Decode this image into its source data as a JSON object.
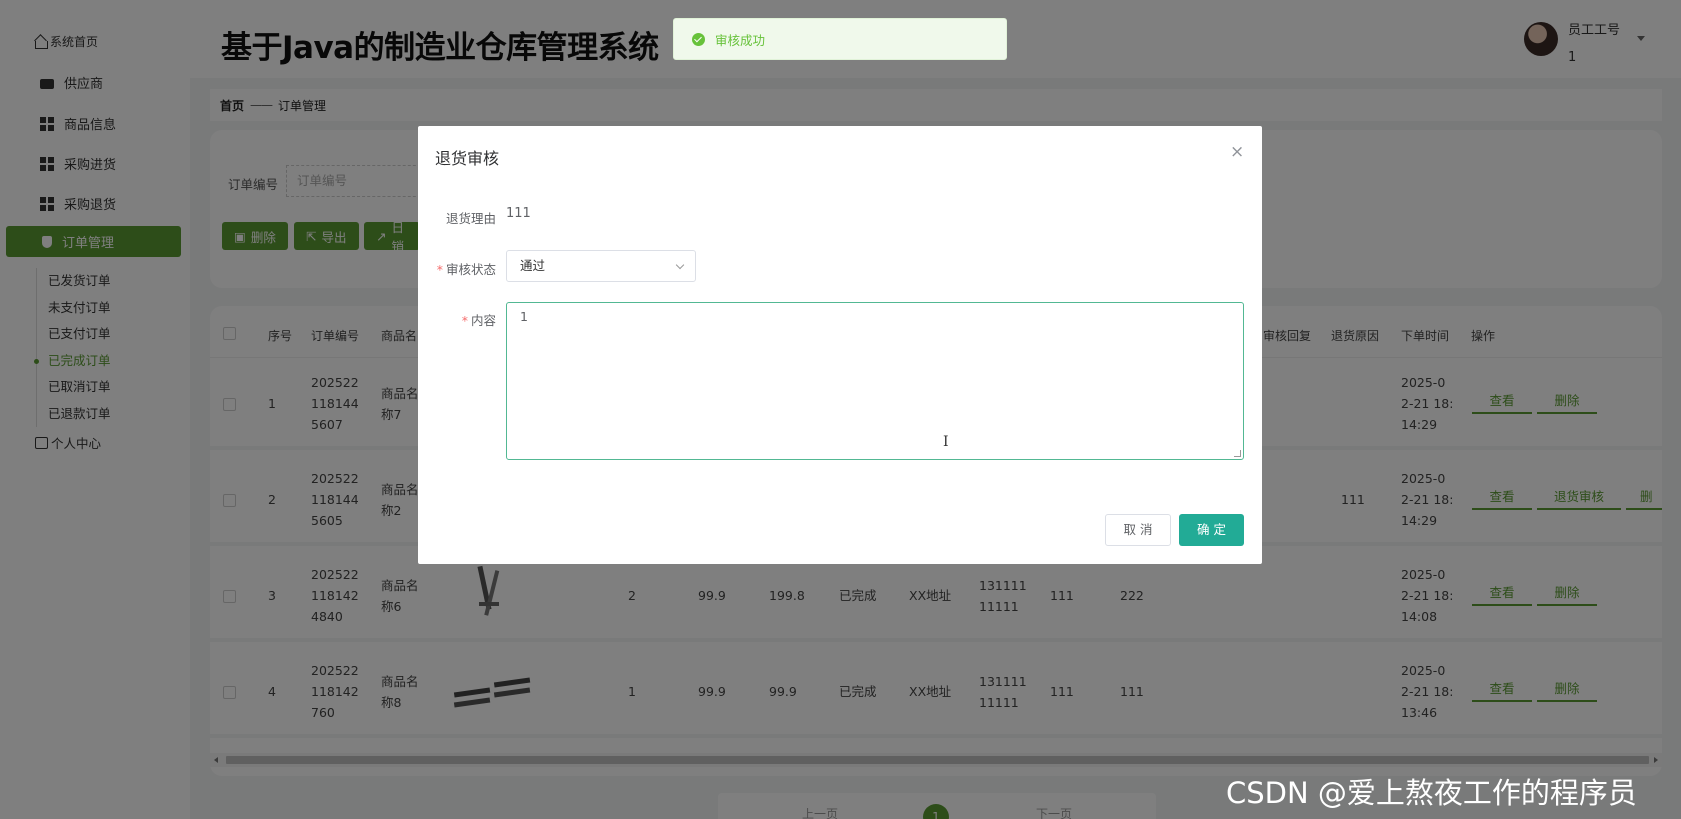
{
  "app_title": "基于Java的制造业仓库管理系统",
  "user": {
    "label": "员工工号",
    "id": "1"
  },
  "sidebar": {
    "home": "系统首页",
    "items": [
      "供应商",
      "商品信息",
      "采购进货",
      "采购退货"
    ],
    "active": "订单管理",
    "sub_items": [
      "已发货订单",
      "未支付订单",
      "已支付订单",
      "已完成订单",
      "已取消订单",
      "已退款订单"
    ],
    "active_sub": "已完成订单",
    "user_center": "个人中心"
  },
  "breadcrumb": {
    "home": "首页",
    "sep": "——",
    "current": "订单管理"
  },
  "search": {
    "label": "订单编号",
    "placeholder": "订单编号"
  },
  "toolbar": {
    "delete": "删除",
    "export": "导出",
    "sales": "日销"
  },
  "table": {
    "headers": [
      "序号",
      "订单编号",
      "商品名",
      "审核回复",
      "退货原因",
      "下单时间",
      "操作"
    ],
    "rows": [
      {
        "idx": "1",
        "order_no": "202522\n118144\n5607",
        "name": "商品名\n称7",
        "qty": "",
        "price": "",
        "total": "",
        "status": "",
        "addr": "",
        "phone": "",
        "c1": "",
        "c2": "",
        "reason": "",
        "time": "2025-0\n2-21 18:\n14:29",
        "actions": [
          "查看",
          "删除"
        ]
      },
      {
        "idx": "2",
        "order_no": "202522\n118144\n5605",
        "name": "商品名\n称2",
        "qty": "",
        "price": "",
        "total": "",
        "status": "",
        "addr": "",
        "phone": "",
        "c1": "",
        "c2": "",
        "reason": "111",
        "time": "2025-0\n2-21 18:\n14:29",
        "actions": [
          "查看",
          "退货审核",
          "删除"
        ]
      },
      {
        "idx": "3",
        "order_no": "202522\n118142\n4840",
        "name": "商品名\n称6",
        "qty": "2",
        "price": "99.9",
        "total": "199.8",
        "status": "已完成",
        "addr": "XX地址",
        "phone": "131111\n11111",
        "c1": "111",
        "c2": "222",
        "reason": "",
        "time": "2025-0\n2-21 18:\n14:08",
        "actions": [
          "查看",
          "删除"
        ]
      },
      {
        "idx": "4",
        "order_no": "202522\n118142\n760",
        "name": "商品名\n称8",
        "qty": "1",
        "price": "99.9",
        "total": "99.9",
        "status": "已完成",
        "addr": "XX地址",
        "phone": "131111\n11111",
        "c1": "111",
        "c2": "111",
        "reason": "",
        "time": "2025-0\n2-21 18:\n13:46",
        "actions": [
          "查看",
          "删除"
        ]
      }
    ]
  },
  "pager": {
    "prev": "上一页",
    "current": "1",
    "next": "下一页"
  },
  "dialog": {
    "title": "退货审核",
    "close": "×",
    "reason_label": "退货理由",
    "reason_value": "111",
    "status_label": "审核状态",
    "status_value": "通过",
    "content_label": "内容",
    "content_value": "1",
    "cancel": "取 消",
    "confirm": "确 定"
  },
  "toast": {
    "text": "审核成功"
  },
  "watermark": "CSDN @爱上熬夜工作的程序员",
  "colors": {
    "accent": "#5b9b33",
    "confirm": "#22ab96",
    "success": "#67c23a"
  }
}
